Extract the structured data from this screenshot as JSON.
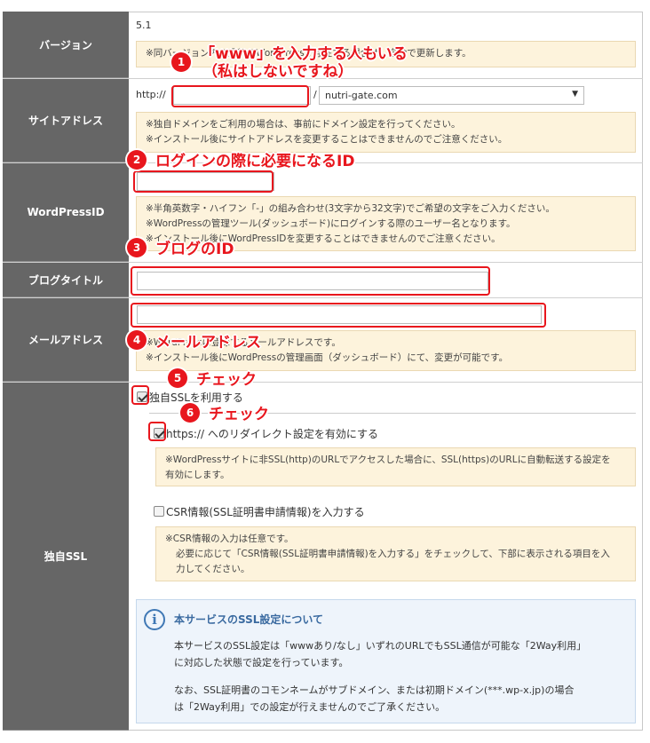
{
  "version": {
    "label": "バージョン",
    "value": "5.1",
    "note": "※同バージョン内の最新のWordPressが存在する場合は、自動で更新します。"
  },
  "site": {
    "label": "サイトアドレス",
    "prefix": "http://",
    "domain": "nutri-gate.com",
    "slash": "/",
    "note": [
      "※独自ドメインをご利用の場合は、事前にドメイン設定を行ってください。",
      "※インストール後にサイトアドレスを変更することはできませんのでご注意ください。"
    ]
  },
  "wpid": {
    "label": "WordPressID",
    "note": [
      "※半角英数字・ハイフン「-」の組み合わせ(3文字から32文字)でご希望の文字をご入力ください。",
      "※WordPressの管理ツール(ダッシュボード)にログインする際のユーザー名となります。",
      "※インストール後にWordPressIDを変更することはできませんのでご注意ください。"
    ]
  },
  "blog": {
    "label": "ブログタイトル"
  },
  "mail": {
    "label": "メールアドレス",
    "note": [
      "※WordPressに登録するメールアドレスです。",
      "※インストール後にWordPressの管理画面（ダッシュボード）にて、変更が可能です。"
    ]
  },
  "ssl": {
    "label": "独自SSL",
    "use_ssl": "独自SSLを利用する",
    "redirect": "https:// へのリダイレクト設定を有効にする",
    "redirect_note": [
      "※WordPressサイトに非SSL(http)のURLでアクセスした場合に、SSL(https)のURLに自動転送する設定を",
      "有効にします。"
    ],
    "csr": "CSR情報(SSL証明書申請情報)を入力する",
    "csr_note": [
      "※CSR情報の入力は任意です。",
      "必要に応じて「CSR情報(SSL証明書申請情報)を入力する」をチェックして、下部に表示される項目を入",
      "力してください。"
    ],
    "info_title": "本サービスのSSL設定について",
    "info_p1": [
      "本サービスのSSL設定は「wwwあり/なし」いずれのURLでもSSL通信が可能な「2Way利用」",
      "に対応した状態で設定を行っています。"
    ],
    "info_p2": [
      "なお、SSL証明書のコモンネームがサブドメイン、または初期ドメイン(***.wp-x.jp)の場合",
      "は「2Way利用」での設定が行えませんのでご了承ください。"
    ]
  },
  "annotations": {
    "a1": "「www」を入力する人もいる",
    "a1b": "（私はしないですね）",
    "a2": "ログインの際に必要になるID",
    "a3": "ブログのID",
    "a4": "メールアドレス",
    "a5": "チェック",
    "a6": "チェック",
    "n1": "1",
    "n2": "2",
    "n3": "3",
    "n4": "4",
    "n5": "5",
    "n6": "6"
  }
}
